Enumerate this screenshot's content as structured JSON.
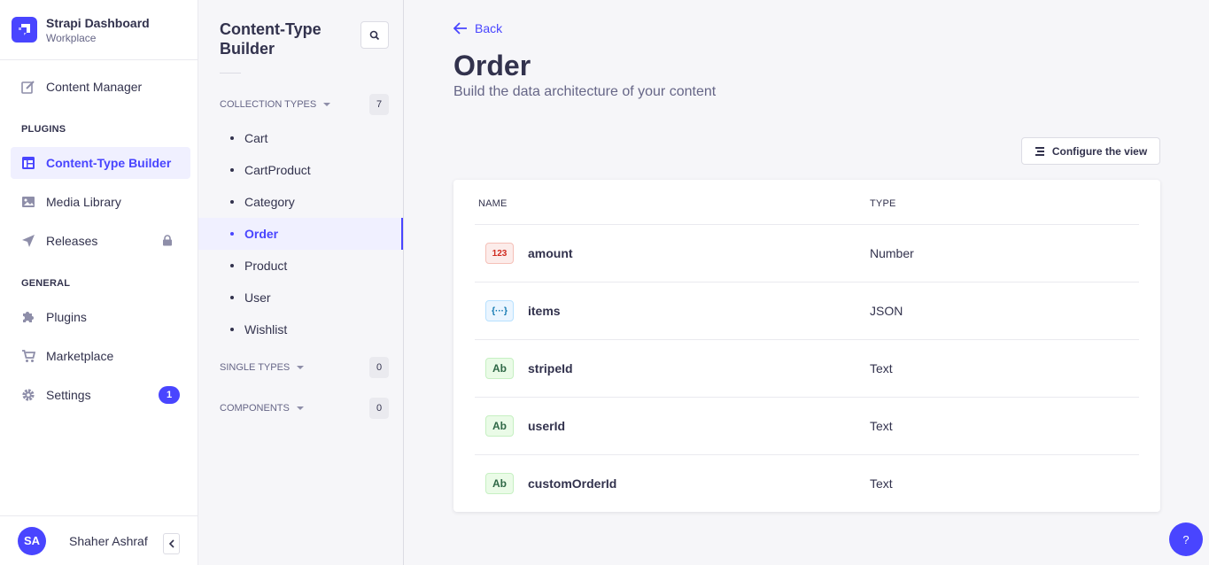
{
  "brand": {
    "title": "Strapi Dashboard",
    "subtitle": "Workplace"
  },
  "mainnav": {
    "content_manager": "Content Manager",
    "plugins_section": "PLUGINS",
    "content_type_builder": "Content-Type Builder",
    "media_library": "Media Library",
    "releases": "Releases",
    "general_section": "GENERAL",
    "plugins": "Plugins",
    "marketplace": "Marketplace",
    "settings": "Settings",
    "settings_badge": "1"
  },
  "user": {
    "initials": "SA",
    "name": "Shaher Ashraf"
  },
  "subnav": {
    "title": "Content-Type Builder",
    "collection_types": {
      "label": "COLLECTION TYPES",
      "count": "7",
      "items": [
        "Cart",
        "CartProduct",
        "Category",
        "Order",
        "Product",
        "User",
        "Wishlist"
      ]
    },
    "single_types": {
      "label": "SINGLE TYPES",
      "count": "0"
    },
    "components": {
      "label": "COMPONENTS",
      "count": "0"
    }
  },
  "content": {
    "back": "Back",
    "title": "Order",
    "subtitle": "Build the data architecture of your content",
    "configure": "Configure the view",
    "columns": {
      "name": "NAME",
      "type": "TYPE"
    },
    "fields": [
      {
        "badge": "123",
        "name": "amount",
        "type": "Number"
      },
      {
        "badge": "{···}",
        "name": "items",
        "type": "JSON"
      },
      {
        "badge": "Ab",
        "name": "stripeId",
        "type": "Text"
      },
      {
        "badge": "Ab",
        "name": "userId",
        "type": "Text"
      },
      {
        "badge": "Ab",
        "name": "customOrderId",
        "type": "Text"
      }
    ]
  },
  "help": "?",
  "colors": {
    "primary": "#4945ff",
    "active_bg": "#f0f0ff"
  }
}
